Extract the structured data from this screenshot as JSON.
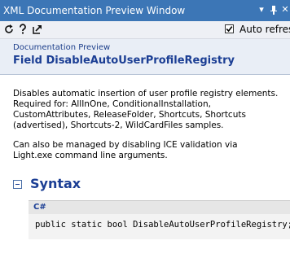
{
  "window": {
    "title": "XML Documentation Preview Window",
    "controls": {
      "pin_icon": "pin-icon",
      "close_icon": "close-icon",
      "menu_icon": "dropdown-icon"
    }
  },
  "toolbar": {
    "icons": [
      "refresh-icon",
      "help-icon",
      "navigate-icon"
    ],
    "auto_refresh": {
      "label": "Auto refresh",
      "checked": true
    }
  },
  "header": {
    "subtitle": "Documentation Preview",
    "title": "Field DisableAutoUserProfileRegistry"
  },
  "description": {
    "lines": [
      "Disables automatic insertion of user profile registry elements.",
      "Required for: AllInOne, ConditionalInstallation,",
      "CustomAttributes, ReleaseFolder, Shortcuts, Shortcuts",
      "(advertised), Shortcuts-2, WildCardFiles samples."
    ]
  },
  "note": {
    "lines": [
      "Can also be managed by disabling ICE validation via",
      "Light.exe command line arguments."
    ]
  },
  "syntax": {
    "heading": "Syntax",
    "language": "C#",
    "code": "public static bool DisableAutoUserProfileRegistry;"
  },
  "colors": {
    "titlebar": "#3c76b6",
    "accent_text": "#1b3e94",
    "header_bg": "#e9eef6"
  }
}
